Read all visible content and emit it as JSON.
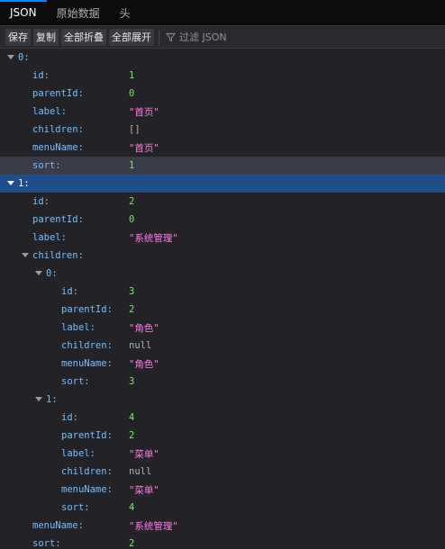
{
  "tabs": [
    {
      "label": "JSON",
      "active": true
    },
    {
      "label": "原始数据",
      "active": false
    },
    {
      "label": "头",
      "active": false
    }
  ],
  "toolbar": {
    "save": "保存",
    "copy": "复制",
    "collapse_all": "全部折叠",
    "expand_all": "全部展开",
    "filter_placeholder": "过滤 JSON",
    "filter_icon": "filter-icon"
  },
  "colors": {
    "accent": "#0a84ff",
    "key": "#75bfff",
    "number": "#86de74",
    "string": "#ff7de9",
    "selected_row": "#204e8a",
    "hover_row": "#393b46"
  },
  "tree": {
    "item0": {
      "key": "0:",
      "id_k": "id:",
      "id_v": "1",
      "parentId_k": "parentId:",
      "parentId_v": "0",
      "label_k": "label:",
      "label_v": "\"首页\"",
      "children_k": "children:",
      "children_v": "[]",
      "menuName_k": "menuName:",
      "menuName_v": "\"首页\"",
      "sort_k": "sort:",
      "sort_v": "1"
    },
    "item1": {
      "key": "1:",
      "id_k": "id:",
      "id_v": "2",
      "parentId_k": "parentId:",
      "parentId_v": "0",
      "label_k": "label:",
      "label_v": "\"系统管理\"",
      "children_k": "children:",
      "child0": {
        "key": "0:",
        "id_k": "id:",
        "id_v": "3",
        "parentId_k": "parentId:",
        "parentId_v": "2",
        "label_k": "label:",
        "label_v": "\"角色\"",
        "children_k": "children:",
        "children_v": "null",
        "menuName_k": "menuName:",
        "menuName_v": "\"角色\"",
        "sort_k": "sort:",
        "sort_v": "3"
      },
      "child1": {
        "key": "1:",
        "id_k": "id:",
        "id_v": "4",
        "parentId_k": "parentId:",
        "parentId_v": "2",
        "label_k": "label:",
        "label_v": "\"菜单\"",
        "children_k": "children:",
        "children_v": "null",
        "menuName_k": "menuName:",
        "menuName_v": "\"菜单\"",
        "sort_k": "sort:",
        "sort_v": "4"
      },
      "menuName_k": "menuName:",
      "menuName_v": "\"系统管理\"",
      "sort_k": "sort:",
      "sort_v": "2"
    }
  }
}
